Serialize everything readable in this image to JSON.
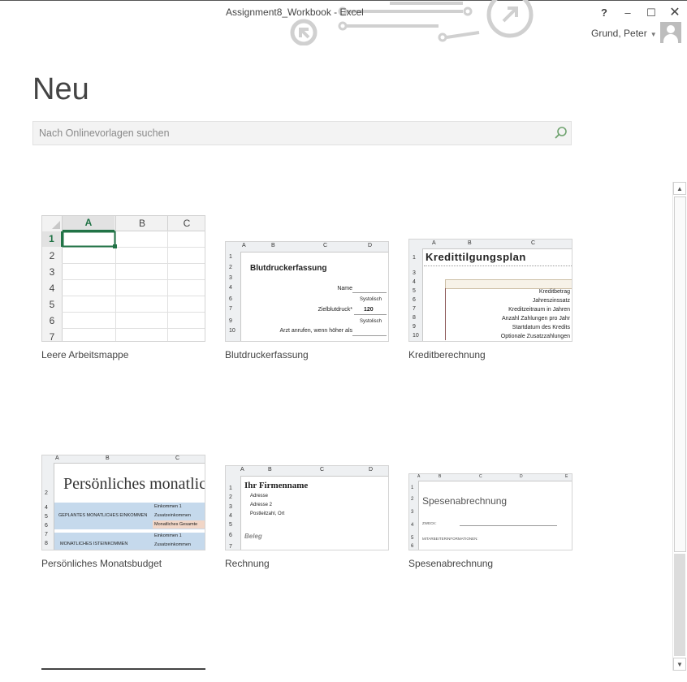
{
  "window": {
    "title": "Assignment8_Workbook - Excel",
    "help": "?",
    "minimize": "–",
    "maximize": "☐",
    "close": "✕",
    "account_name": "Grund, Peter"
  },
  "page": {
    "title": "Neu"
  },
  "search": {
    "placeholder": "Nach Onlinevorlagen suchen",
    "icon": "search-icon"
  },
  "templates": [
    {
      "label": "Leere Arbeitsmappe"
    },
    {
      "label": "Blutdruckerfassung"
    },
    {
      "label": "Kreditberechnung"
    },
    {
      "label": "Persönliches Monatsbudget"
    },
    {
      "label": "Rechnung"
    },
    {
      "label": "Spesenabrechnung"
    }
  ],
  "blank": {
    "cols": [
      "A",
      "B",
      "C"
    ],
    "rows": [
      "1",
      "2",
      "3",
      "4",
      "5",
      "6",
      "7"
    ],
    "accent": "#217346"
  },
  "bp": {
    "cols": [
      "A",
      "B",
      "C",
      "D"
    ],
    "rows": [
      "1",
      "2",
      "3",
      "4",
      "6",
      "7",
      "9",
      "10"
    ],
    "title": "Blutdruckerfassung",
    "name": "Name",
    "syst1": "Systolisch",
    "target": "Zielblutdruck*",
    "value": "120",
    "syst2": "Systolisch",
    "doctor": "Arzt anrufen, wenn höher als"
  },
  "loan": {
    "cols": [
      "A",
      "B",
      "C"
    ],
    "rows": [
      "1",
      "3",
      "4",
      "5",
      "6",
      "7",
      "8",
      "9",
      "10"
    ],
    "title": "Kredittilgungsplan",
    "lines": [
      "Kreditbetrag",
      "Jahreszinssatz",
      "Kreditzeitraum in Jahren",
      "Anzahl Zahlungen pro Jahr",
      "Startdatum des Kredits",
      "Optionale Zusatzzahlungen"
    ]
  },
  "budget": {
    "cols": [
      "A",
      "B",
      "C"
    ],
    "title": "Persönliches monatliches",
    "rows": [
      "2",
      "4",
      "5",
      "6",
      "7",
      "8"
    ],
    "left1": "GEPLANTES MONATLICHES EINKOMMEN",
    "left2": "MONATLICHES ISTEINKOMMEN",
    "r1": "Einkommen 1",
    "r2": "Zusatzeinkommen",
    "r3": "Monatliches Gesamte",
    "r4": "Einkommen 1",
    "r5": "Zusatzeinkommen"
  },
  "invoice": {
    "cols": [
      "A",
      "B",
      "C",
      "D"
    ],
    "rows": [
      "1",
      "2",
      "3",
      "4",
      "5",
      "6",
      "7"
    ],
    "company": "Ihr Firmenname",
    "addr1": "Adresse",
    "addr2": "Adresse 2",
    "zip": "Postleitzahl, Ort",
    "doc": "Beleg"
  },
  "expense": {
    "cols": [
      "A",
      "B",
      "C",
      "D",
      "E"
    ],
    "rows": [
      "1",
      "2",
      "3",
      "4",
      "5",
      "6"
    ],
    "title": "Spesenabrechnung",
    "purpose": "ZWECK:",
    "employee": "MITARBEITERINFORMATIONEN:"
  },
  "scroll": {
    "up": "▲",
    "down": "▼"
  }
}
